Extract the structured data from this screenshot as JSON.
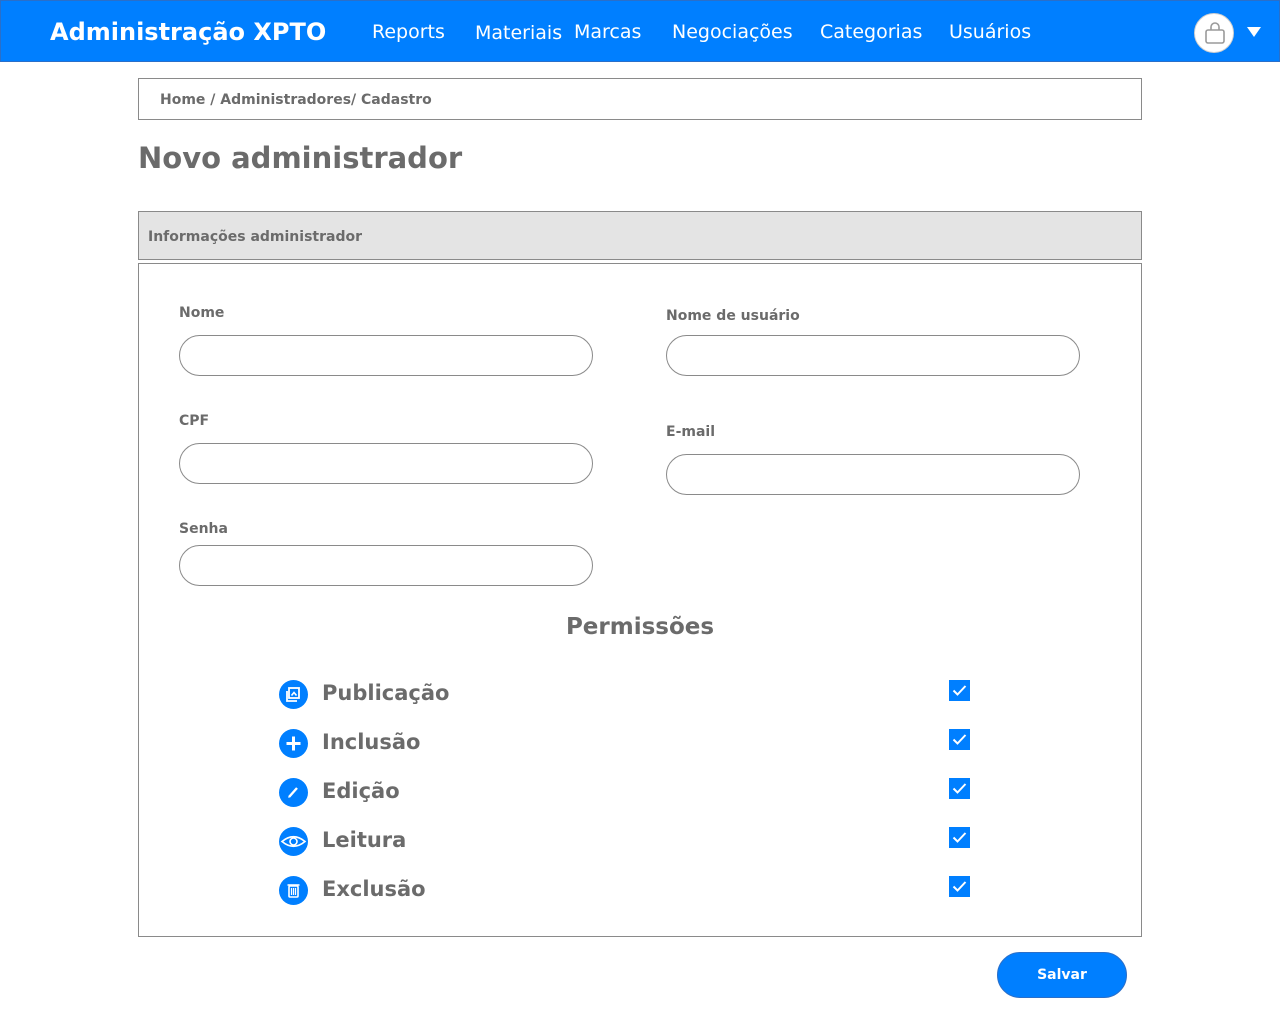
{
  "header": {
    "brand": "Administração XPTO",
    "nav": [
      "Reports",
      "Materiais",
      "Marcas",
      "Negociações",
      "Categorias",
      "Usuários"
    ],
    "user_icon": "user-icon",
    "menu_icon": "chevron-down-icon"
  },
  "breadcrumb": "Home / Administradores/ Cadastro",
  "page_title": "Novo administrador",
  "section_title": "Informações administrador",
  "form": {
    "nome": {
      "label": "Nome",
      "value": ""
    },
    "usuario": {
      "label": "Nome de usuário",
      "value": ""
    },
    "cpf": {
      "label": "CPF",
      "value": ""
    },
    "email": {
      "label": "E-mail",
      "value": ""
    },
    "senha": {
      "label": "Senha",
      "value": ""
    }
  },
  "permissions": {
    "title": "Permissões",
    "items": [
      {
        "label": "Publicação",
        "icon": "publish-icon",
        "checked": true
      },
      {
        "label": "Inclusão",
        "icon": "plus-icon",
        "checked": true
      },
      {
        "label": "Edição",
        "icon": "pencil-icon",
        "checked": true
      },
      {
        "label": "Leitura",
        "icon": "eye-icon",
        "checked": true
      },
      {
        "label": "Exclusão",
        "icon": "trash-icon",
        "checked": true
      }
    ]
  },
  "actions": {
    "save_label": "Salvar"
  },
  "colors": {
    "accent": "#007fff",
    "text": "#6b6b6b",
    "section_bg": "#e4e4e4",
    "border": "#8a8a8a"
  }
}
